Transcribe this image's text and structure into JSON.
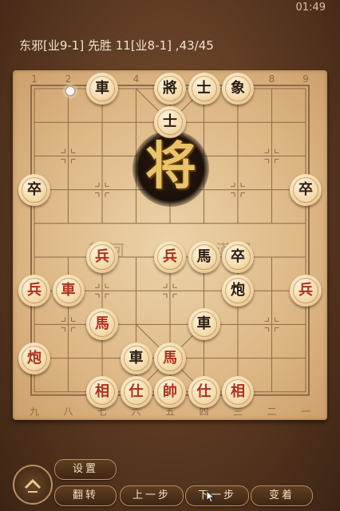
{
  "status_bar": {
    "time": "01:49"
  },
  "game": {
    "title": "东邪[业9-1] 先胜 11[业8-1] ,43/45"
  },
  "board": {
    "top_coords": [
      "1",
      "2",
      "3",
      "4",
      "5",
      "6",
      "7",
      "8",
      "9"
    ],
    "bottom_coords": [
      "九",
      "八",
      "七",
      "六",
      "五",
      "四",
      "三",
      "二",
      "一"
    ],
    "river_left": "楚河",
    "river_right": "漢界",
    "emblem": "将",
    "pieces": [
      {
        "name": "black-chariot",
        "label": "車",
        "side": "black",
        "file": 3,
        "rank": 0
      },
      {
        "name": "black-general",
        "label": "將",
        "side": "black",
        "file": 5,
        "rank": 0
      },
      {
        "name": "black-advisor",
        "label": "士",
        "side": "black",
        "file": 6,
        "rank": 0
      },
      {
        "name": "black-elephant",
        "label": "象",
        "side": "black",
        "file": 7,
        "rank": 0
      },
      {
        "name": "black-advisor-2",
        "label": "士",
        "side": "black",
        "file": 5,
        "rank": 1
      },
      {
        "name": "black-soldier-left",
        "label": "卒",
        "side": "black",
        "file": 1,
        "rank": 3
      },
      {
        "name": "black-soldier-right",
        "label": "卒",
        "side": "black",
        "file": 9,
        "rank": 3
      },
      {
        "name": "black-soldier-center",
        "label": "卒",
        "side": "black",
        "file": 7,
        "rank": 5
      },
      {
        "name": "black-horse",
        "label": "馬",
        "side": "black",
        "file": 6,
        "rank": 5
      },
      {
        "name": "black-cannon",
        "label": "炮",
        "side": "black",
        "file": 7,
        "rank": 6
      },
      {
        "name": "black-chariot-2",
        "label": "車",
        "side": "black",
        "file": 6,
        "rank": 7
      },
      {
        "name": "black-chariot-3",
        "label": "車",
        "side": "black",
        "file": 4,
        "rank": 8
      },
      {
        "name": "red-soldier-a",
        "label": "兵",
        "side": "red",
        "file": 3,
        "rank": 5
      },
      {
        "name": "red-soldier-b",
        "label": "兵",
        "side": "red",
        "file": 5,
        "rank": 5
      },
      {
        "name": "red-soldier-c",
        "label": "兵",
        "side": "red",
        "file": 1,
        "rank": 6
      },
      {
        "name": "red-soldier-d",
        "label": "兵",
        "side": "red",
        "file": 9,
        "rank": 6
      },
      {
        "name": "red-chariot",
        "label": "車",
        "side": "red",
        "file": 2,
        "rank": 6
      },
      {
        "name": "red-horse",
        "label": "馬",
        "side": "red",
        "file": 3,
        "rank": 7
      },
      {
        "name": "red-cannon",
        "label": "炮",
        "side": "red",
        "file": 1,
        "rank": 8
      },
      {
        "name": "red-horse-2",
        "label": "馬",
        "side": "red",
        "file": 5,
        "rank": 8
      },
      {
        "name": "red-elephant-left",
        "label": "相",
        "side": "red",
        "file": 3,
        "rank": 9
      },
      {
        "name": "red-advisor-left",
        "label": "仕",
        "side": "red",
        "file": 4,
        "rank": 9
      },
      {
        "name": "red-general",
        "label": "帥",
        "side": "red",
        "file": 5,
        "rank": 9
      },
      {
        "name": "red-advisor-right",
        "label": "仕",
        "side": "red",
        "file": 6,
        "rank": 9
      },
      {
        "name": "red-elephant-right",
        "label": "相",
        "side": "red",
        "file": 7,
        "rank": 9
      }
    ]
  },
  "controls": {
    "menu_icon": "chevron-up-icon",
    "settings": "设置",
    "flip": "翻转",
    "prev": "上一步",
    "next": "下一步",
    "variation": "变着"
  },
  "colors": {
    "red_piece": "#b0301c",
    "black_piece": "#2b1c12",
    "board": "#ddb886"
  }
}
